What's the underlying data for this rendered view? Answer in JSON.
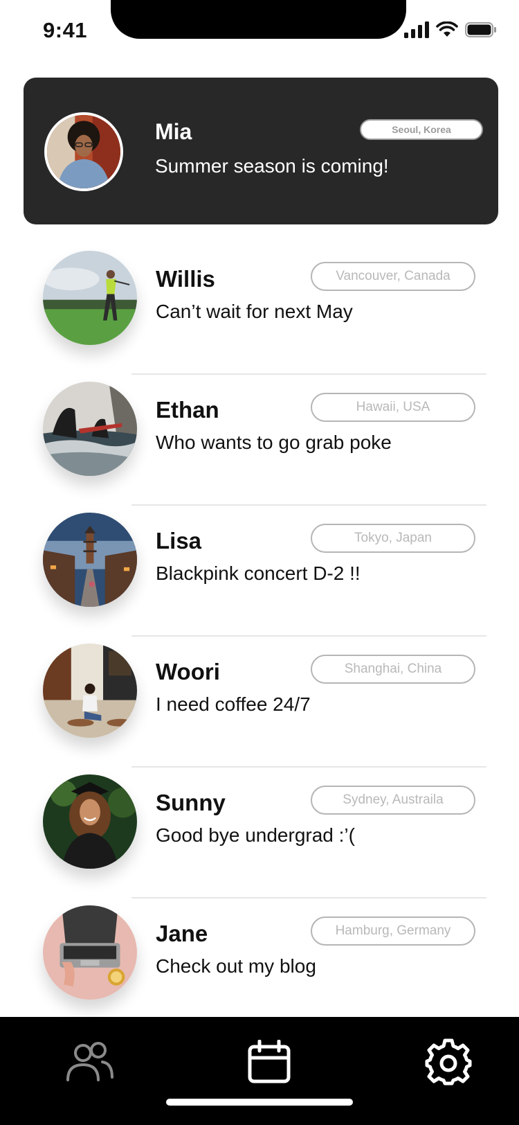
{
  "status_bar": {
    "time": "9:41",
    "icons": [
      "signal-icon",
      "wifi-icon",
      "battery-icon"
    ]
  },
  "featured": {
    "name": "Mia",
    "message": "Summer season is coming!",
    "location": "Seoul, Korea",
    "avatar": "portrait-photo"
  },
  "contacts": [
    {
      "name": "Willis",
      "message": "Can’t wait for next May",
      "location": "Vancouver, Canada",
      "avatar": "golfer-photo"
    },
    {
      "name": "Ethan",
      "message": "Who wants to go grab poke",
      "location": "Hawaii, USA",
      "avatar": "surfers-photo"
    },
    {
      "name": "Lisa",
      "message": "Blackpink concert D-2 !!",
      "location": "Tokyo, Japan",
      "avatar": "pagoda-street-photo"
    },
    {
      "name": "Woori",
      "message": "I need coffee 24/7",
      "location": "Shanghai, China",
      "avatar": "cafe-photo"
    },
    {
      "name": "Sunny",
      "message": "Good bye undergrad :’(",
      "location": "Sydney, Austraila",
      "avatar": "graduate-photo"
    },
    {
      "name": "Jane",
      "message": "Check out my blog",
      "location": "Hamburg, Germany",
      "avatar": "laptop-photo"
    }
  ],
  "tab_bar": {
    "tabs": [
      "people-icon",
      "calendar-icon",
      "gear-icon"
    ]
  },
  "colors": {
    "featured_bg": "#282828",
    "tab_bar_bg": "#000000",
    "divider": "#e6e6e6",
    "pill_border": "#b5b5b5",
    "pill_text": "#b8b8b8"
  }
}
